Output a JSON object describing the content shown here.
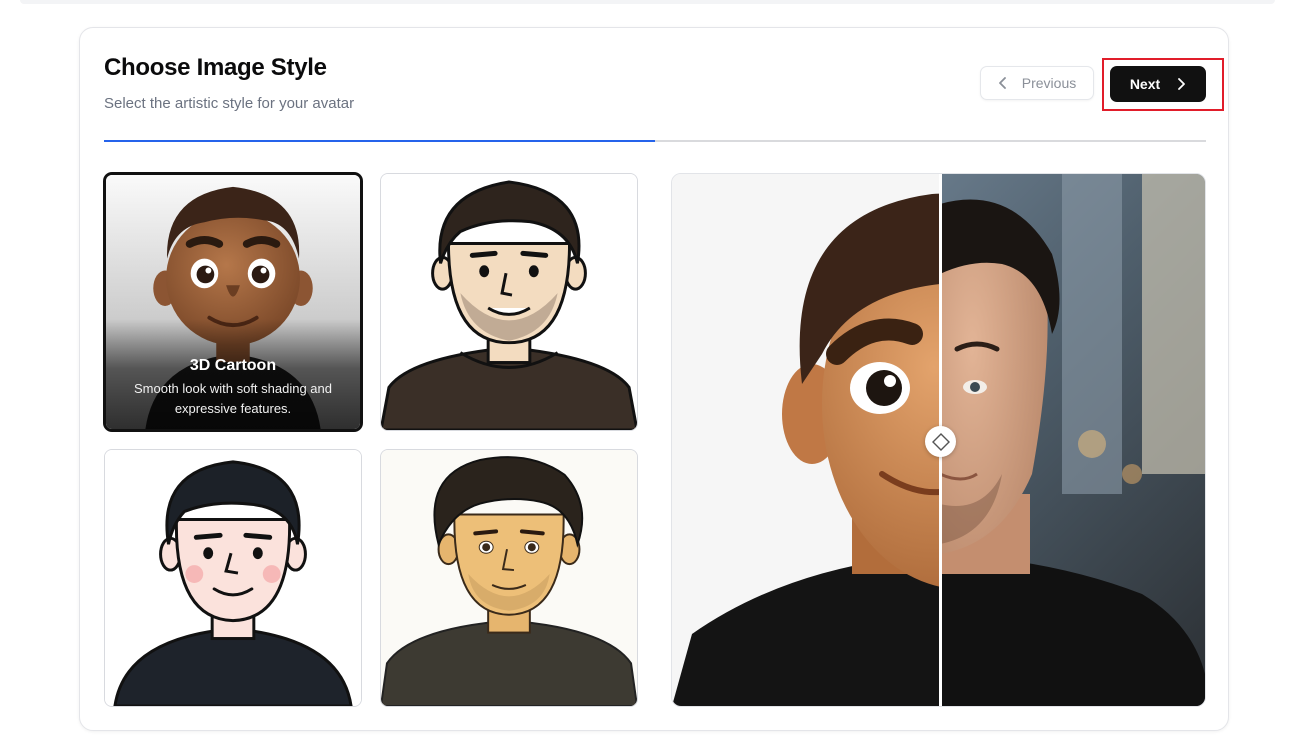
{
  "header": {
    "title": "Choose Image Style",
    "subtitle": "Select the artistic style for your avatar"
  },
  "nav": {
    "previous_label": "Previous",
    "next_label": "Next"
  },
  "progress": {
    "fraction": 0.5
  },
  "styles": [
    {
      "name": "3D Cartoon",
      "description": "Smooth look with soft shading and expressive features.",
      "selected": true,
      "icon": "3d-cartoon-avatar"
    },
    {
      "icon": "line-art-avatar",
      "selected": false
    },
    {
      "icon": "flat-cartoon-avatar",
      "selected": false
    },
    {
      "icon": "illustrated-avatar",
      "selected": false
    }
  ],
  "comparison": {
    "split": 0.5,
    "left_icon": "3d-cartoon-face",
    "right_icon": "photo-face",
    "handle_icon": "diamond-handle-icon"
  },
  "colors": {
    "accent": "#2563eb",
    "primary_button": "#111111",
    "highlight": "#e11d2a"
  }
}
